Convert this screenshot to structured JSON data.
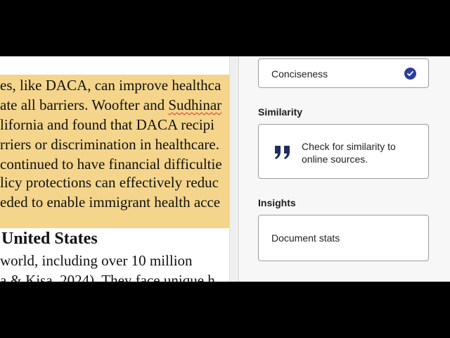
{
  "document": {
    "lines": [
      "es, like DACA, can improve healthca",
      "ate all barriers. Woofter and ",
      "lifornia and found that DACA recipi",
      "rriers or discrimination in healthcare.",
      "continued to have financial difficultie",
      "licy protections can effectively reduc",
      "eded to enable immigrant health acce"
    ],
    "misspelled_word": "Sudhinar",
    "heading": "United States",
    "after_lines": [
      "world, including over 10 million",
      "a & Kisa, 2024). They face unique h"
    ]
  },
  "panel": {
    "conciseness_label": "Conciseness",
    "similarity_title": "Similarity",
    "similarity_text": "Check for similarity to online sources.",
    "insights_title": "Insights",
    "document_stats_label": "Document stats"
  },
  "colors": {
    "highlight": "#f4d58b",
    "check": "#2b3d9e",
    "quote": "#1f2c5c"
  }
}
